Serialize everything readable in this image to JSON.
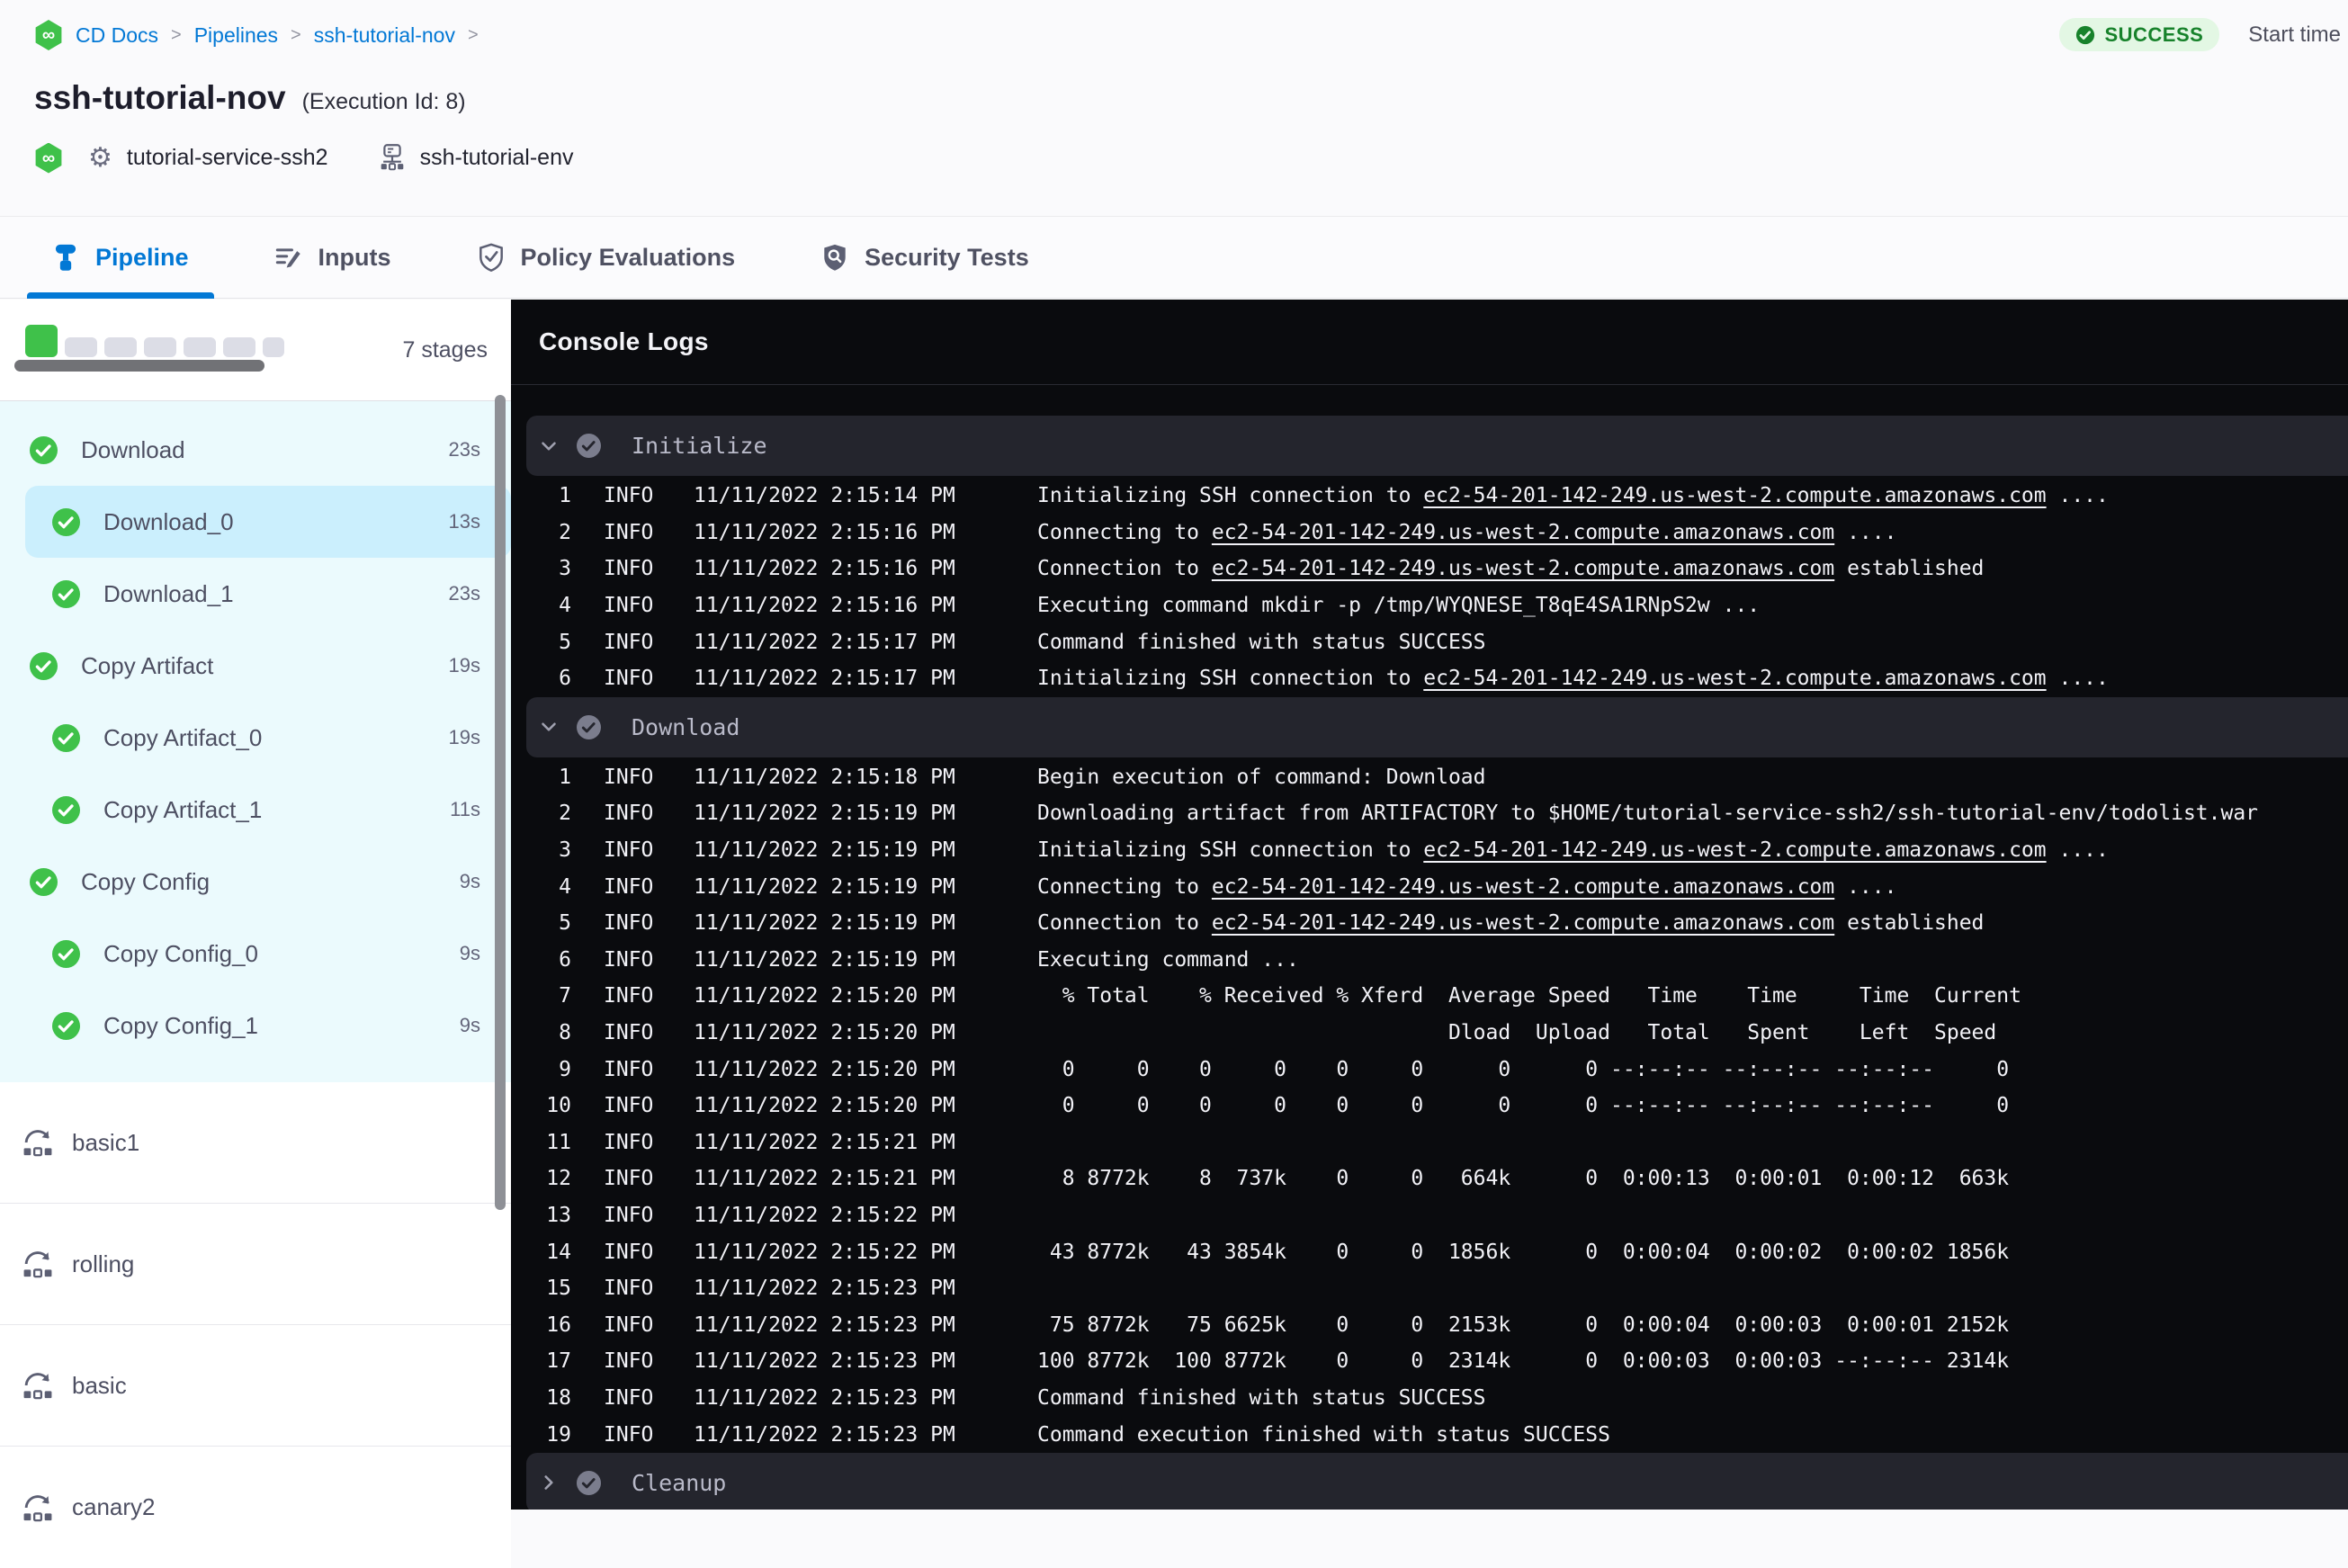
{
  "breadcrumb": {
    "items": [
      "CD Docs",
      "Pipelines",
      "ssh-tutorial-nov"
    ],
    "separator": ">"
  },
  "status": {
    "badge": "SUCCESS",
    "start_time_label": "Start time"
  },
  "header": {
    "title": "ssh-tutorial-nov",
    "execution_id": "(Execution Id: 8)",
    "service": "tutorial-service-ssh2",
    "environment": "ssh-tutorial-env"
  },
  "tabs": [
    {
      "label": "Pipeline",
      "active": true
    },
    {
      "label": "Inputs",
      "active": false
    },
    {
      "label": "Policy Evaluations",
      "active": false
    },
    {
      "label": "Security Tests",
      "active": false
    }
  ],
  "sidebar": {
    "stage_count_label": "7 stages",
    "progress_squares": {
      "total": 7,
      "completed": 1
    },
    "stages": [
      {
        "name": "Download",
        "duration": "23s",
        "level": 0,
        "selected": false
      },
      {
        "name": "Download_0",
        "duration": "13s",
        "level": 1,
        "selected": true
      },
      {
        "name": "Download_1",
        "duration": "23s",
        "level": 1,
        "selected": false
      },
      {
        "name": "Copy Artifact",
        "duration": "19s",
        "level": 0,
        "selected": false
      },
      {
        "name": "Copy Artifact_0",
        "duration": "19s",
        "level": 1,
        "selected": false
      },
      {
        "name": "Copy Artifact_1",
        "duration": "11s",
        "level": 1,
        "selected": false
      },
      {
        "name": "Copy Config",
        "duration": "9s",
        "level": 0,
        "selected": false
      },
      {
        "name": "Copy Config_0",
        "duration": "9s",
        "level": 1,
        "selected": false
      },
      {
        "name": "Copy Config_1",
        "duration": "9s",
        "level": 1,
        "selected": false
      }
    ],
    "pipelines": [
      "basic1",
      "rolling",
      "basic",
      "canary2"
    ]
  },
  "console": {
    "title": "Console Logs",
    "sections": [
      {
        "name": "Initialize",
        "expanded": true,
        "lines": [
          {
            "n": 1,
            "lvl": "INFO",
            "time": "11/11/2022 2:15:14 PM",
            "msg": [
              {
                "t": "Initializing SSH connection to "
              },
              {
                "t": "ec2-54-201-142-249.us-west-2.compute.amazonaws.com",
                "link": true
              },
              {
                "t": " ...."
              }
            ]
          },
          {
            "n": 2,
            "lvl": "INFO",
            "time": "11/11/2022 2:15:16 PM",
            "msg": [
              {
                "t": "Connecting to "
              },
              {
                "t": "ec2-54-201-142-249.us-west-2.compute.amazonaws.com",
                "link": true
              },
              {
                "t": " ...."
              }
            ]
          },
          {
            "n": 3,
            "lvl": "INFO",
            "time": "11/11/2022 2:15:16 PM",
            "msg": [
              {
                "t": "Connection to "
              },
              {
                "t": "ec2-54-201-142-249.us-west-2.compute.amazonaws.com",
                "link": true
              },
              {
                "t": " established"
              }
            ]
          },
          {
            "n": 4,
            "lvl": "INFO",
            "time": "11/11/2022 2:15:16 PM",
            "msg": [
              {
                "t": "Executing command mkdir -p /tmp/WYQNESE_T8qE4SA1RNpS2w ..."
              }
            ]
          },
          {
            "n": 5,
            "lvl": "INFO",
            "time": "11/11/2022 2:15:17 PM",
            "msg": [
              {
                "t": "Command finished with status SUCCESS"
              }
            ]
          },
          {
            "n": 6,
            "lvl": "INFO",
            "time": "11/11/2022 2:15:17 PM",
            "msg": [
              {
                "t": "Initializing SSH connection to "
              },
              {
                "t": "ec2-54-201-142-249.us-west-2.compute.amazonaws.com",
                "link": true
              },
              {
                "t": " ...."
              }
            ]
          }
        ]
      },
      {
        "name": "Download",
        "expanded": true,
        "lines": [
          {
            "n": 1,
            "lvl": "INFO",
            "time": "11/11/2022 2:15:18 PM",
            "msg": [
              {
                "t": "Begin execution of command: Download"
              }
            ]
          },
          {
            "n": 2,
            "lvl": "INFO",
            "time": "11/11/2022 2:15:19 PM",
            "msg": [
              {
                "t": "Downloading artifact from ARTIFACTORY to $HOME/tutorial-service-ssh2/ssh-tutorial-env/todolist.war"
              }
            ]
          },
          {
            "n": 3,
            "lvl": "INFO",
            "time": "11/11/2022 2:15:19 PM",
            "msg": [
              {
                "t": "Initializing SSH connection to "
              },
              {
                "t": "ec2-54-201-142-249.us-west-2.compute.amazonaws.com",
                "link": true
              },
              {
                "t": " ...."
              }
            ]
          },
          {
            "n": 4,
            "lvl": "INFO",
            "time": "11/11/2022 2:15:19 PM",
            "msg": [
              {
                "t": "Connecting to "
              },
              {
                "t": "ec2-54-201-142-249.us-west-2.compute.amazonaws.com",
                "link": true
              },
              {
                "t": " ...."
              }
            ]
          },
          {
            "n": 5,
            "lvl": "INFO",
            "time": "11/11/2022 2:15:19 PM",
            "msg": [
              {
                "t": "Connection to "
              },
              {
                "t": "ec2-54-201-142-249.us-west-2.compute.amazonaws.com",
                "link": true
              },
              {
                "t": " established"
              }
            ]
          },
          {
            "n": 6,
            "lvl": "INFO",
            "time": "11/11/2022 2:15:19 PM",
            "msg": [
              {
                "t": "Executing command ..."
              }
            ]
          },
          {
            "n": 7,
            "lvl": "INFO",
            "time": "11/11/2022 2:15:20 PM",
            "msg": [
              {
                "t": "  % Total    % Received % Xferd  Average Speed   Time    Time     Time  Current"
              }
            ]
          },
          {
            "n": 8,
            "lvl": "INFO",
            "time": "11/11/2022 2:15:20 PM",
            "msg": [
              {
                "t": "                                 Dload  Upload   Total   Spent    Left  Speed"
              }
            ]
          },
          {
            "n": 9,
            "lvl": "INFO",
            "time": "11/11/2022 2:15:20 PM",
            "msg": [
              {
                "t": "  0     0    0     0    0     0      0      0 --:--:-- --:--:-- --:--:--     0"
              }
            ]
          },
          {
            "n": 10,
            "lvl": "INFO",
            "time": "11/11/2022 2:15:20 PM",
            "msg": [
              {
                "t": "  0     0    0     0    0     0      0      0 --:--:-- --:--:-- --:--:--     0"
              }
            ]
          },
          {
            "n": 11,
            "lvl": "INFO",
            "time": "11/11/2022 2:15:21 PM",
            "msg": []
          },
          {
            "n": 12,
            "lvl": "INFO",
            "time": "11/11/2022 2:15:21 PM",
            "msg": [
              {
                "t": "  8 8772k    8  737k    0     0   664k      0  0:00:13  0:00:01  0:00:12  663k"
              }
            ]
          },
          {
            "n": 13,
            "lvl": "INFO",
            "time": "11/11/2022 2:15:22 PM",
            "msg": []
          },
          {
            "n": 14,
            "lvl": "INFO",
            "time": "11/11/2022 2:15:22 PM",
            "msg": [
              {
                "t": " 43 8772k   43 3854k    0     0  1856k      0  0:00:04  0:00:02  0:00:02 1856k"
              }
            ]
          },
          {
            "n": 15,
            "lvl": "INFO",
            "time": "11/11/2022 2:15:23 PM",
            "msg": []
          },
          {
            "n": 16,
            "lvl": "INFO",
            "time": "11/11/2022 2:15:23 PM",
            "msg": [
              {
                "t": " 75 8772k   75 6625k    0     0  2153k      0  0:00:04  0:00:03  0:00:01 2152k"
              }
            ]
          },
          {
            "n": 17,
            "lvl": "INFO",
            "time": "11/11/2022 2:15:23 PM",
            "msg": [
              {
                "t": "100 8772k  100 8772k    0     0  2314k      0  0:00:03  0:00:03 --:--:-- 2314k"
              }
            ]
          },
          {
            "n": 18,
            "lvl": "INFO",
            "time": "11/11/2022 2:15:23 PM",
            "msg": [
              {
                "t": "Command finished with status SUCCESS"
              }
            ]
          },
          {
            "n": 19,
            "lvl": "INFO",
            "time": "11/11/2022 2:15:23 PM",
            "msg": [
              {
                "t": "Command execution finished with status SUCCESS"
              }
            ]
          }
        ]
      },
      {
        "name": "Cleanup",
        "expanded": false,
        "lines": []
      }
    ]
  },
  "colors": {
    "accent_blue": "#0278d5",
    "success_green": "#3fc14a",
    "badge_bg": "#e3f7e4",
    "badge_text": "#17822b",
    "console_bg": "#0a0b0e",
    "section_bar_bg": "#24252d",
    "stage_list_bg": "#ebfafd",
    "selected_stage_bg": "#cbeffd"
  }
}
